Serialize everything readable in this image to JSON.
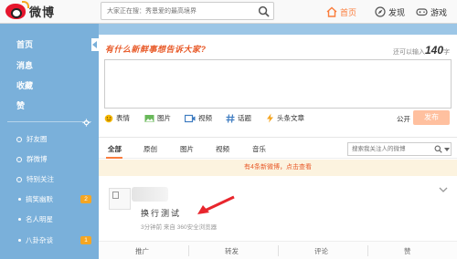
{
  "logo": {
    "text": "微博"
  },
  "search": {
    "placeholder": "大家正在搜：秀恩爱的最高境界"
  },
  "nav": {
    "home": "首页",
    "discover": "发现",
    "game": "游戏"
  },
  "colors": {
    "accent": "#fa7d3c",
    "sidebar": "#7ab0da",
    "notice_bg": "#fcf3df",
    "publish_disabled": "#ffc09f"
  },
  "sidebar": {
    "main_items": [
      "首页",
      "消息",
      "收藏",
      "赞"
    ],
    "groups": [
      {
        "label": "好友圈",
        "badge": ""
      },
      {
        "label": "群微博",
        "badge": ""
      },
      {
        "label": "特别关注",
        "badge": ""
      },
      {
        "label": "搞笑幽默",
        "badge": "2"
      },
      {
        "label": "名人明星",
        "badge": ""
      },
      {
        "label": "八卦杂谈",
        "badge": "1"
      }
    ]
  },
  "compose": {
    "title": "有什么新鲜事想告诉大家?",
    "count_prefix": "还可以输入",
    "count_value": "140",
    "count_suffix": "字",
    "tools": [
      "表情",
      "图片",
      "视频",
      "话题",
      "头条文章"
    ],
    "visibility": "公开",
    "publish": "发布"
  },
  "feed": {
    "tabs": [
      "全部",
      "原创",
      "图片",
      "视频",
      "音乐"
    ],
    "active_tab": "全部",
    "search_placeholder": "搜索我关注人的微博",
    "notice": "有4条新微博，点击查看"
  },
  "post": {
    "text": "换行测试",
    "meta": "3分钟前 来自 360安全浏览器",
    "actions": [
      "推广",
      "转发",
      "评论",
      "赞"
    ]
  }
}
